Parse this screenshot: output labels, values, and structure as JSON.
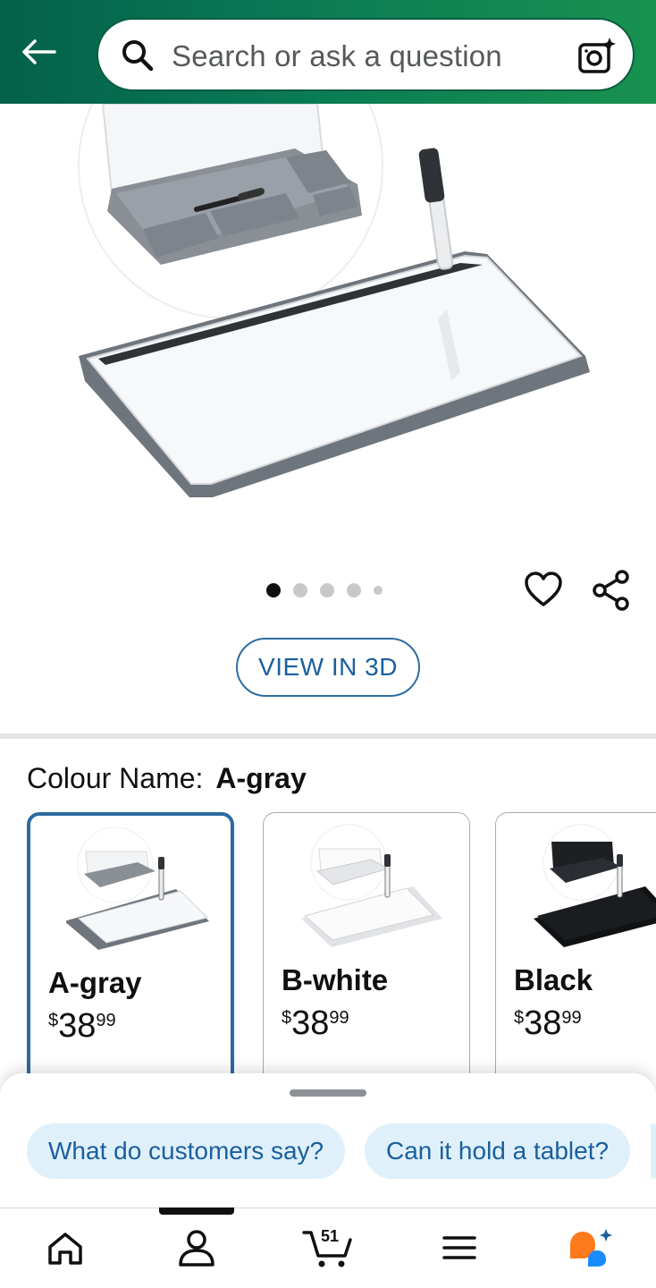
{
  "header": {
    "back_icon": "arrow-left-icon",
    "search": {
      "placeholder": "Search or ask a question",
      "icon": "search-icon",
      "camera_icon": "camera-sparkle-icon"
    }
  },
  "product": {
    "image_carousel": {
      "total_dots": 5,
      "active_index": 0
    },
    "actions": {
      "wishlist_icon": "heart-icon",
      "share_icon": "share-icon"
    },
    "view_3d_label": "VIEW IN 3D"
  },
  "colour": {
    "label": "Colour Name:",
    "selected": "A-gray",
    "options": [
      {
        "name": "A-gray",
        "price": {
          "symbol": "$",
          "whole": "38",
          "fraction": "99"
        },
        "selected": true
      },
      {
        "name": "B-white",
        "price": {
          "symbol": "$",
          "whole": "38",
          "fraction": "99"
        },
        "selected": false
      },
      {
        "name": "Black",
        "price": {
          "symbol": "$",
          "whole": "38",
          "fraction": "99"
        },
        "selected": false
      }
    ]
  },
  "suggestions": {
    "chips": [
      "What do customers say?",
      "Can it hold a tablet?"
    ]
  },
  "nav": {
    "items": [
      {
        "name": "home",
        "icon": "home-icon"
      },
      {
        "name": "account",
        "icon": "user-icon"
      },
      {
        "name": "cart",
        "icon": "cart-icon",
        "count": "51"
      },
      {
        "name": "menu",
        "icon": "hamburger-icon"
      },
      {
        "name": "rufus",
        "icon": "rufus-assistant-icon"
      }
    ],
    "active_index": 1
  },
  "colors": {
    "accent": "#1a5f9e",
    "header_gradient_start": "#04614a",
    "header_gradient_end": "#18924f",
    "chip_bg": "#dff0fb"
  }
}
